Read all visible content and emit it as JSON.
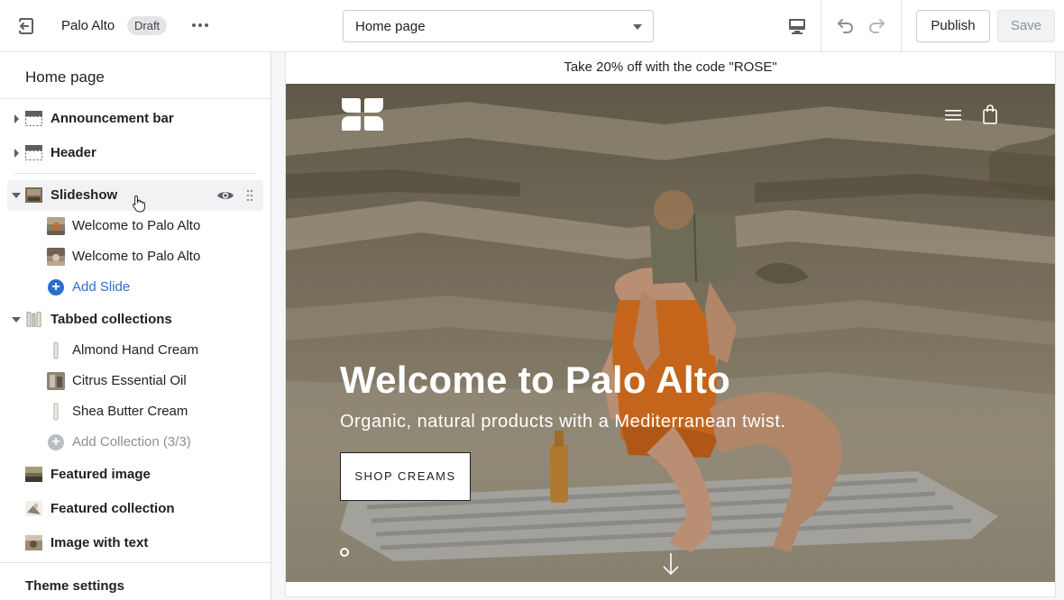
{
  "topbar": {
    "store_name": "Palo Alto",
    "status_badge": "Draft",
    "page_select": "Home page",
    "publish_label": "Publish",
    "save_label": "Save"
  },
  "sidebar": {
    "title": "Home page",
    "sections": {
      "announcement": "Announcement bar",
      "header": "Header",
      "slideshow": "Slideshow",
      "slides": [
        "Welcome to Palo Alto",
        "Welcome to Palo Alto"
      ],
      "add_slide": "Add Slide",
      "tabbed": "Tabbed collections",
      "collections": [
        "Almond Hand Cream",
        "Citrus Essential Oil",
        "Shea Butter Cream"
      ],
      "add_collection": "Add Collection (3/3)",
      "featured_image": "Featured image",
      "featured_collection": "Featured collection",
      "image_with_text": "Image with text"
    },
    "theme_settings": "Theme settings"
  },
  "preview": {
    "announcement": "Take 20% off with the code \"ROSE\"",
    "hero_title": "Welcome to Palo Alto",
    "hero_subtitle": "Organic, natural products with a Mediterranean twist.",
    "hero_button": "SHOP CREAMS"
  },
  "colors": {
    "accent_link": "#2c6ecb",
    "badge_bg": "#e4e5e7",
    "selected_row": "#f1f2f3"
  },
  "icons": [
    "exit-icon",
    "more-icon",
    "desktop-icon",
    "undo-icon",
    "redo-icon",
    "eye-icon",
    "drag-handle-icon",
    "plus-circle-icon",
    "hamburger-icon",
    "bag-icon",
    "arrow-down-icon",
    "logo-icon"
  ]
}
